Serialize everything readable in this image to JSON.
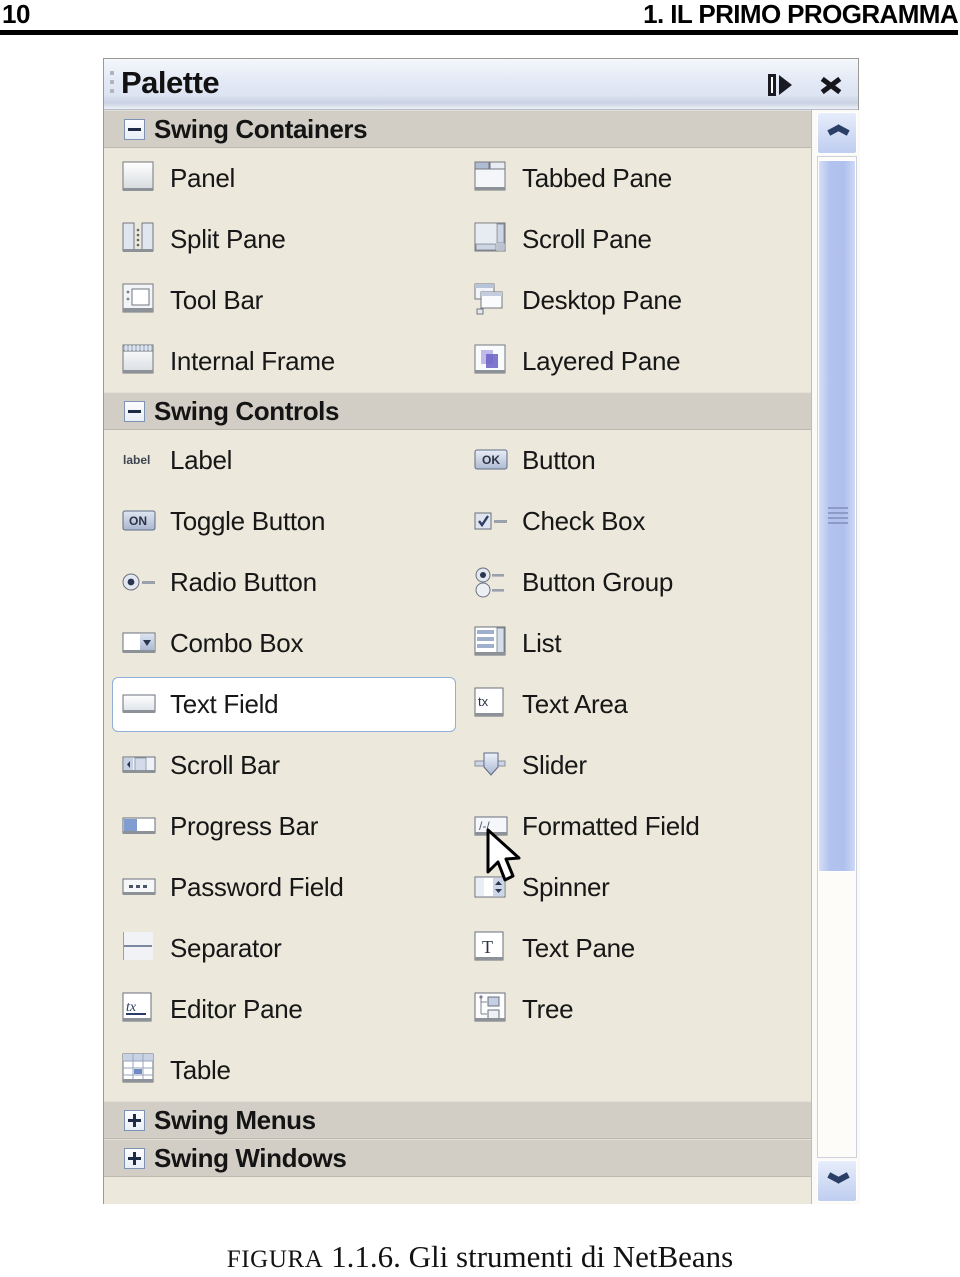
{
  "page": {
    "number": "10",
    "running_head": "1. IL PRIMO PROGRAMMA",
    "caption_prefix": "FIGURA",
    "caption_rest": " 1.1.6.  Gli strumenti di NetBeans"
  },
  "palette": {
    "title": "Palette",
    "dock_icon": "dock-panel-icon",
    "close_icon": "close-icon",
    "grip_icon": "drag-grip-icon",
    "colors": {
      "window_bg": "#ece8dc",
      "section_header_bg": "#d2cec6",
      "titlebar_top": "#f4f7fc",
      "titlebar_bottom": "#c9d2e4",
      "selection_border": "#8fb0d9",
      "selection_bg": "#ffffff",
      "scrollbar_thumb": "#b3c3ef"
    },
    "sections": [
      {
        "label": "Swing Containers",
        "expanded": true,
        "expander_state": "minus",
        "rows": [
          [
            {
              "label": "Panel",
              "icon": "panel-icon",
              "selected": false
            },
            {
              "label": "Tabbed Pane",
              "icon": "tabbed-pane-icon",
              "selected": false
            }
          ],
          [
            {
              "label": "Split Pane",
              "icon": "split-pane-icon",
              "selected": false
            },
            {
              "label": "Scroll Pane",
              "icon": "scroll-pane-icon",
              "selected": false
            }
          ],
          [
            {
              "label": "Tool Bar",
              "icon": "tool-bar-icon",
              "selected": false
            },
            {
              "label": "Desktop Pane",
              "icon": "desktop-pane-icon",
              "selected": false
            }
          ],
          [
            {
              "label": "Internal Frame",
              "icon": "internal-frame-icon",
              "selected": false
            },
            {
              "label": "Layered Pane",
              "icon": "layered-pane-icon",
              "selected": false
            }
          ]
        ]
      },
      {
        "label": "Swing Controls",
        "expanded": true,
        "expander_state": "minus",
        "rows": [
          [
            {
              "label": "Label",
              "icon": "label-icon",
              "selected": false
            },
            {
              "label": "Button",
              "icon": "button-icon",
              "selected": false
            }
          ],
          [
            {
              "label": "Toggle Button",
              "icon": "toggle-button-icon",
              "selected": false
            },
            {
              "label": "Check Box",
              "icon": "check-box-icon",
              "selected": false
            }
          ],
          [
            {
              "label": "Radio Button",
              "icon": "radio-button-icon",
              "selected": false
            },
            {
              "label": "Button Group",
              "icon": "button-group-icon",
              "selected": false
            }
          ],
          [
            {
              "label": "Combo Box",
              "icon": "combo-box-icon",
              "selected": false
            },
            {
              "label": "List",
              "icon": "list-icon",
              "selected": false
            }
          ],
          [
            {
              "label": "Text Field",
              "icon": "text-field-icon",
              "selected": true
            },
            {
              "label": "Text Area",
              "icon": "text-area-icon",
              "selected": false
            }
          ],
          [
            {
              "label": "Scroll Bar",
              "icon": "scroll-bar-icon",
              "selected": false
            },
            {
              "label": "Slider",
              "icon": "slider-icon",
              "selected": false
            }
          ],
          [
            {
              "label": "Progress Bar",
              "icon": "progress-bar-icon",
              "selected": false
            },
            {
              "label": "Formatted Field",
              "icon": "formatted-field-icon",
              "selected": false
            }
          ],
          [
            {
              "label": "Password Field",
              "icon": "password-field-icon",
              "selected": false
            },
            {
              "label": "Spinner",
              "icon": "spinner-icon",
              "selected": false
            }
          ],
          [
            {
              "label": "Separator",
              "icon": "separator-icon",
              "selected": false
            },
            {
              "label": "Text Pane",
              "icon": "text-pane-icon",
              "selected": false
            }
          ],
          [
            {
              "label": "Editor Pane",
              "icon": "editor-pane-icon",
              "selected": false
            },
            {
              "label": "Tree",
              "icon": "tree-icon",
              "selected": false
            }
          ],
          [
            {
              "label": "Table",
              "icon": "table-icon",
              "selected": false
            },
            null
          ]
        ]
      },
      {
        "label": "Swing Menus",
        "expanded": false,
        "expander_state": "plus",
        "rows": []
      },
      {
        "label": "Swing Windows",
        "expanded": false,
        "expander_state": "plus",
        "rows": []
      }
    ],
    "scrollbar": {
      "up_icon": "chevron-up-icon",
      "down_icon": "chevron-down-icon",
      "thumb_icon": "scrollbar-thumb-grip"
    },
    "cursor": "mouse-pointer-cursor"
  }
}
